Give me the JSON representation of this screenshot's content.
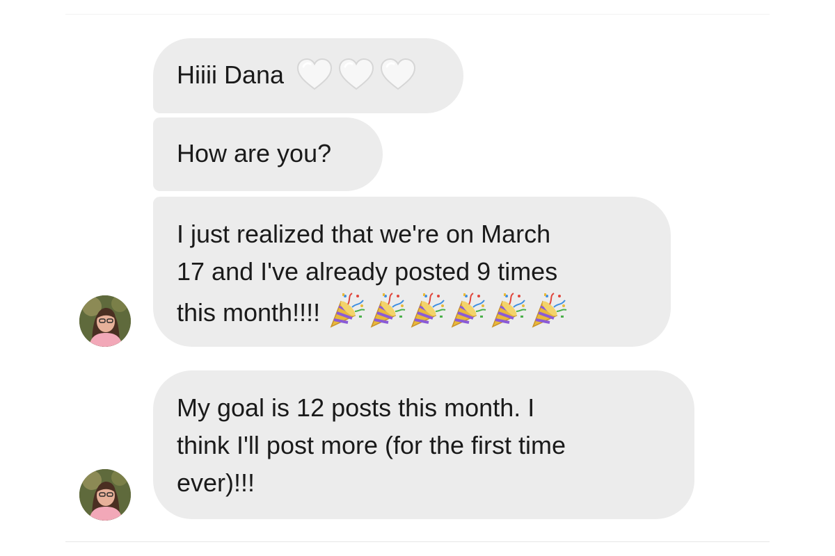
{
  "conversation": {
    "messages": [
      {
        "sender": "contact",
        "lines": [
          "Hiiii Dana"
        ],
        "emoji": "white-heart",
        "emoji_count": 3
      },
      {
        "sender": "contact",
        "lines": [
          "How are you?"
        ]
      },
      {
        "sender": "contact",
        "lines": [
          "I just realized that we're on March",
          "17 and I've already posted 9 times",
          "this month!!!!"
        ],
        "emoji": "party-popper",
        "emoji_count": 6
      },
      {
        "sender": "contact",
        "lines": [
          "My goal is 12 posts this month. I",
          "think I'll post more (for the first time",
          "ever)!!!"
        ]
      }
    ]
  },
  "colors": {
    "page_background": "#ffffff",
    "bubble_background": "#ececec",
    "text": "#1a1a1a"
  },
  "icons": [
    "white-heart-emoji",
    "party-popper-emoji",
    "contact-avatar"
  ]
}
